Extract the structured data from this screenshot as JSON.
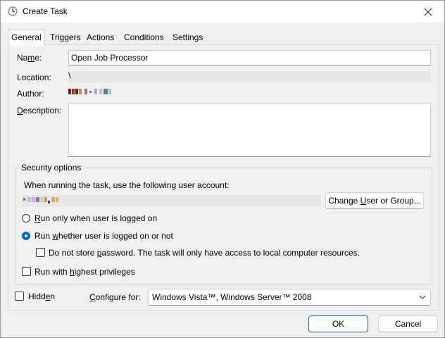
{
  "window": {
    "title": "Create Task",
    "close_glyph": "✕"
  },
  "tabs": [
    "General",
    "Triggers",
    "Actions",
    "Conditions",
    "Settings"
  ],
  "fields": {
    "name_label_pre": "Na",
    "name_label_u": "m",
    "name_label_post": "e:",
    "name_value": "Open Job Processor",
    "location_label": "Location:",
    "location_value": "\\",
    "author_label": "Author:",
    "description_label_pre": "",
    "description_label_u": "D",
    "description_label_post": "escription:"
  },
  "security": {
    "title": "Security options",
    "account_prompt": "When running the task, use the following user account:",
    "change_user_pre": "Change ",
    "change_user_u": "U",
    "change_user_post": "ser or Group...",
    "radio1_pre": "",
    "radio1_u": "R",
    "radio1_post": "un only when user is logged on",
    "radio2_pre": "Run ",
    "radio2_u": "w",
    "radio2_post": "hether user is logged on or not",
    "radio_selected": "run-whether-logged-on",
    "no_store_pre": "Do not store ",
    "no_store_u": "p",
    "no_store_post": "assword.  The task will only have access to local computer resources.",
    "highest_pre": "Run with ",
    "highest_u": "h",
    "highest_post": "ighest privileges"
  },
  "bottom": {
    "hidden_pre": "Hidd",
    "hidden_u": "e",
    "hidden_post": "n",
    "configure_pre": "",
    "configure_u": "C",
    "configure_post": "onfigure for:",
    "configure_value": "Windows Vista™, Windows Server™ 2008",
    "ok_label": "OK",
    "cancel_label": "Cancel"
  },
  "colors": {
    "accent": "#0067c0",
    "window_bg": "#f0f0f0"
  }
}
